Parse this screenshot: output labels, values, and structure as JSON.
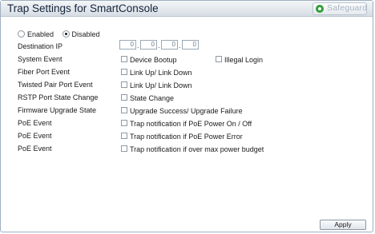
{
  "header": {
    "title": "Trap Settings for SmartConsole",
    "safeguard_label": "Safeguard",
    "safeguard_icon": "green-circle-icon",
    "accent_color": "#2f9e35"
  },
  "state": {
    "options": [
      {
        "label": "Enabled",
        "checked": false
      },
      {
        "label": "Disabled",
        "checked": true
      }
    ]
  },
  "destination_ip": {
    "label": "Destination IP",
    "octets": [
      "0",
      "0",
      "0",
      "0"
    ],
    "separator": "."
  },
  "events": [
    {
      "label": "System Event",
      "options": [
        {
          "label": "Device Bootup",
          "checked": false
        },
        {
          "label": "Illegal Login",
          "checked": false
        }
      ]
    },
    {
      "label": "Fiber Port Event",
      "options": [
        {
          "label": "Link Up/ Link Down",
          "checked": false
        }
      ]
    },
    {
      "label": "Twisted Pair Port Event",
      "options": [
        {
          "label": "Link Up/ Link Down",
          "checked": false
        }
      ]
    },
    {
      "label": "RSTP Port State Change",
      "options": [
        {
          "label": "State Change",
          "checked": false
        }
      ]
    },
    {
      "label": "Firmware Upgrade State",
      "options": [
        {
          "label": "Upgrade Success/ Upgrade Failure",
          "checked": false
        }
      ]
    },
    {
      "label": "PoE Event",
      "options": [
        {
          "label": "Trap notification if PoE Power On / Off",
          "checked": false
        }
      ]
    },
    {
      "label": "PoE Event",
      "options": [
        {
          "label": "Trap notification if PoE Power Error",
          "checked": false
        }
      ]
    },
    {
      "label": "PoE Event",
      "options": [
        {
          "label": "Trap notification if over max power budget",
          "checked": false
        }
      ]
    }
  ],
  "footer": {
    "apply_label": "Apply"
  }
}
